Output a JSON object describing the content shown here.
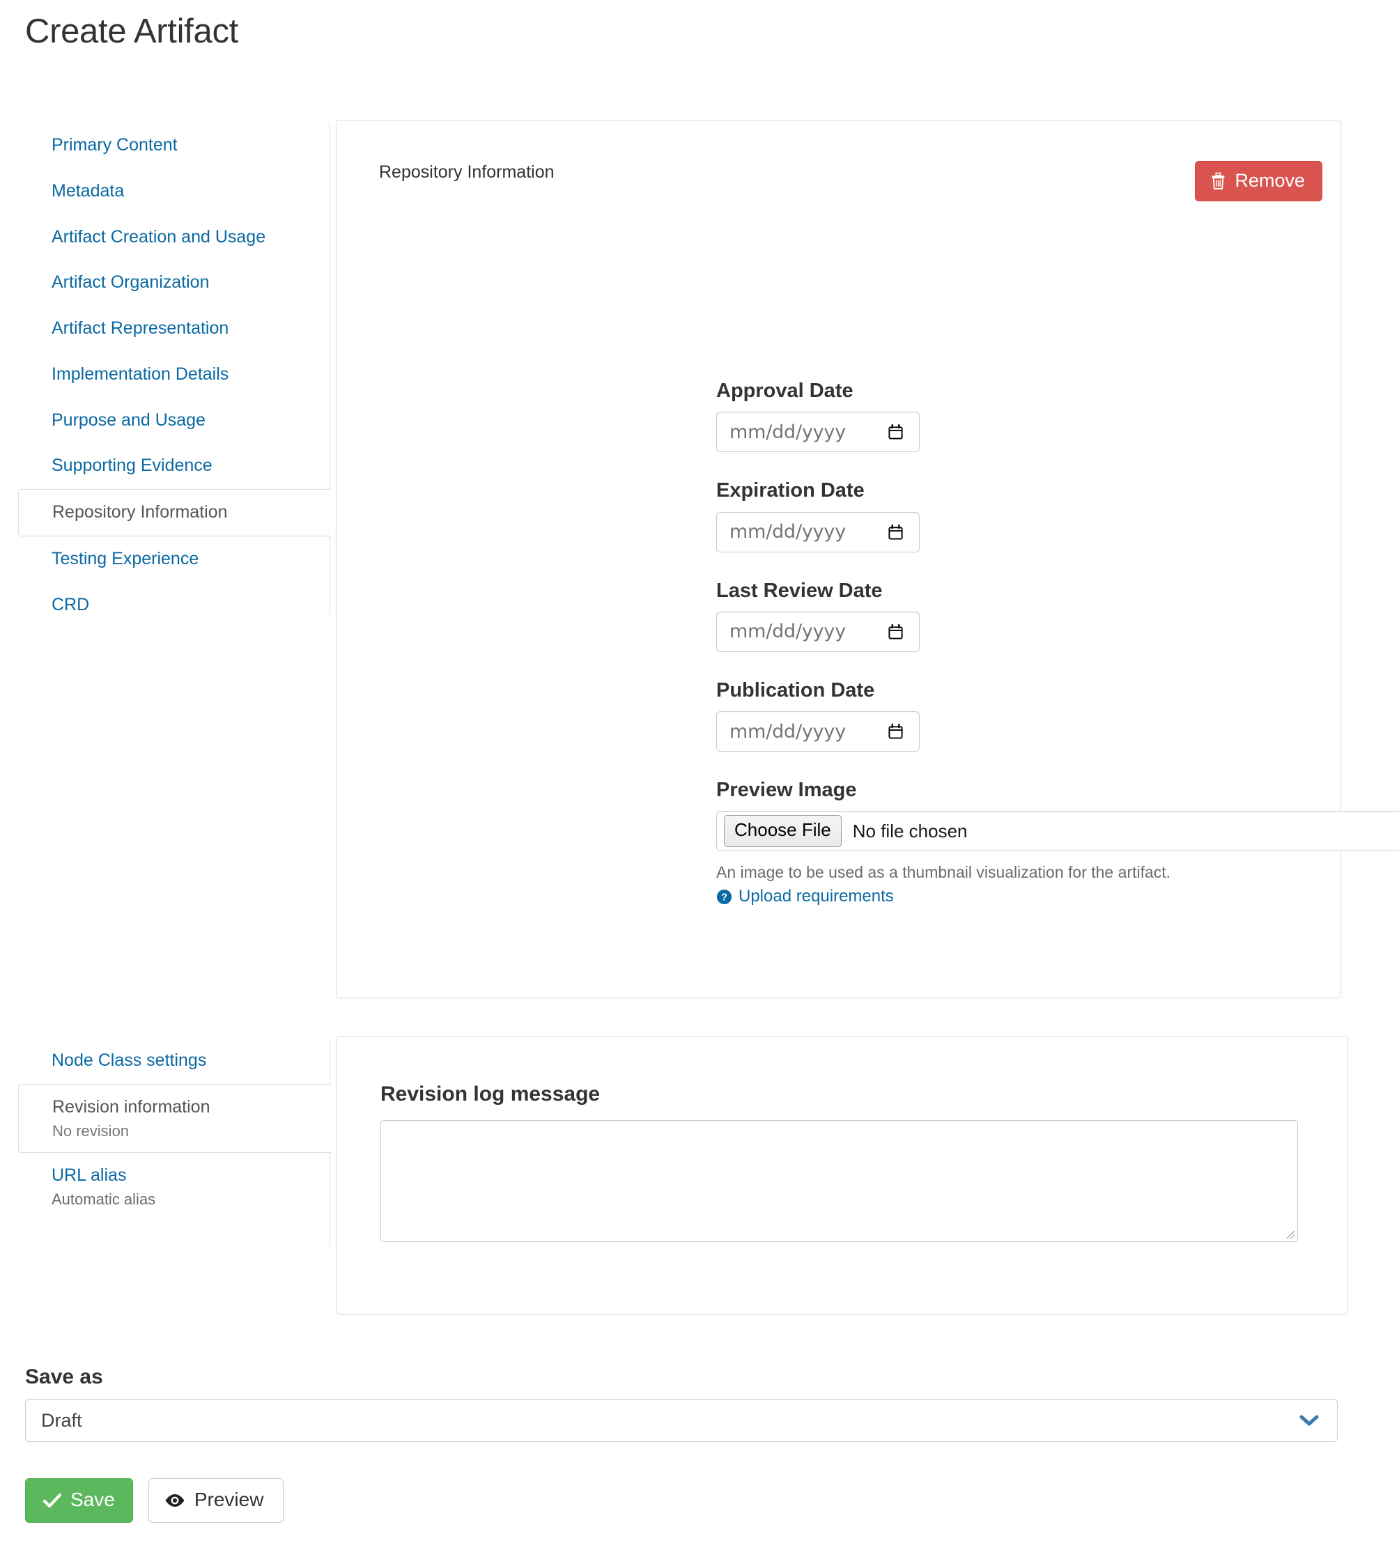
{
  "page": {
    "title": "Create Artifact"
  },
  "primary_nav": {
    "items": [
      {
        "label": "Primary Content",
        "active": false
      },
      {
        "label": "Metadata",
        "active": false
      },
      {
        "label": "Artifact Creation and Usage",
        "active": false
      },
      {
        "label": "Artifact Organization",
        "active": false
      },
      {
        "label": "Artifact Representation",
        "active": false
      },
      {
        "label": "Implementation Details",
        "active": false
      },
      {
        "label": "Purpose and Usage",
        "active": false
      },
      {
        "label": "Supporting Evidence",
        "active": false
      },
      {
        "label": "Repository Information",
        "active": true
      },
      {
        "label": "Testing Experience",
        "active": false
      },
      {
        "label": "CRD",
        "active": false
      }
    ]
  },
  "secondary_nav": {
    "items": [
      {
        "label": "Node Class settings",
        "sub": "",
        "active": false
      },
      {
        "label": "Revision information",
        "sub": "No revision",
        "active": true
      },
      {
        "label": "URL alias",
        "sub": "Automatic alias",
        "active": false
      }
    ]
  },
  "main_panel": {
    "heading": "Repository Information",
    "remove_button": "Remove",
    "remove_icon": "trash-icon",
    "remove_color": "#d9534f",
    "fields": [
      {
        "label": "Approval Date",
        "placeholder": "mm/dd/yyyy",
        "value": ""
      },
      {
        "label": "Expiration Date",
        "placeholder": "mm/dd/yyyy",
        "value": ""
      },
      {
        "label": "Last Review Date",
        "placeholder": "mm/dd/yyyy",
        "value": ""
      },
      {
        "label": "Publication Date",
        "placeholder": "mm/dd/yyyy",
        "value": ""
      }
    ],
    "preview_image": {
      "label": "Preview Image",
      "choose_file_button": "Choose File",
      "file_status": "No file chosen",
      "description": "An image to be used as a thumbnail visualization for the artifact.",
      "help_link": "Upload requirements",
      "help_icon": "question-circle-icon"
    }
  },
  "revision_panel": {
    "label": "Revision log message",
    "value": "",
    "placeholder": ""
  },
  "save_as": {
    "label": "Save as",
    "selected": "Draft",
    "options": [
      "Draft"
    ],
    "chevron_icon": "chevron-down-icon",
    "chevron_color": "#3a7ab0"
  },
  "actions": {
    "save_label": "Save",
    "save_icon": "check-icon",
    "save_color": "#5cb85c",
    "preview_label": "Preview",
    "preview_icon": "eye-icon"
  }
}
